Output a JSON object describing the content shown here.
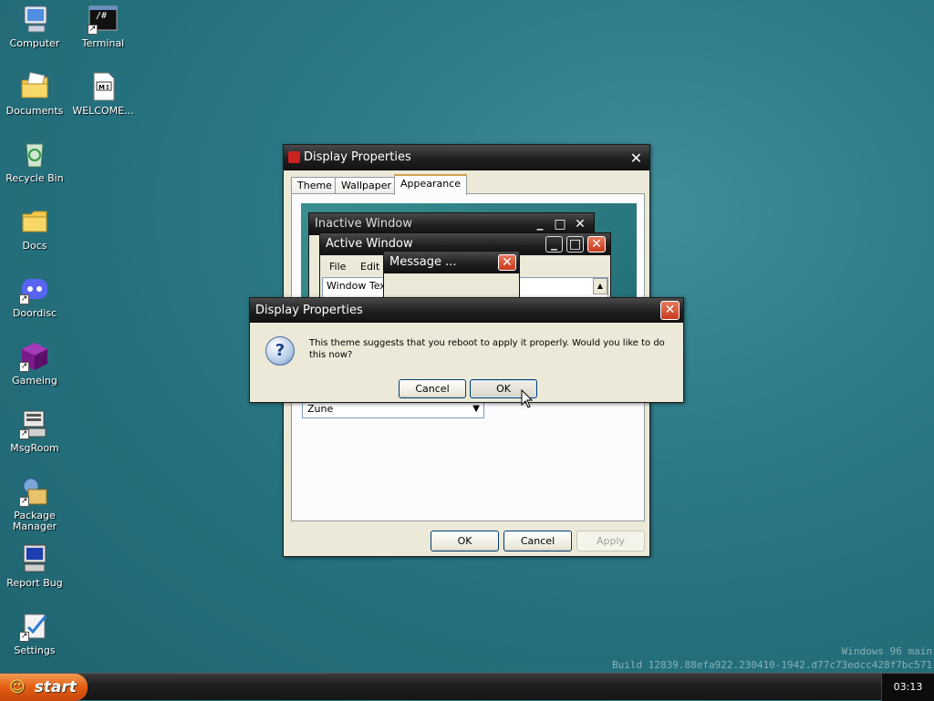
{
  "desktop": {
    "icons": [
      {
        "label": "Computer"
      },
      {
        "label": "Terminal"
      },
      {
        "label": "Documents"
      },
      {
        "label": "WELCOME..."
      },
      {
        "label": "Recycle Bin"
      },
      {
        "label": "Docs"
      },
      {
        "label": "Doordisc"
      },
      {
        "label": "Gameing"
      },
      {
        "label": "MsgRoom"
      },
      {
        "label": "Package Manager"
      },
      {
        "label": "Report Bug"
      },
      {
        "label": "Settings"
      }
    ],
    "terminal_glyph": "/#",
    "welcome_glyph": "M↕"
  },
  "display_properties": {
    "title": "Display Properties",
    "close_glyph": "✕",
    "tabs": [
      "Theme",
      "Wallpaper",
      "Appearance"
    ],
    "active_tab": "Appearance",
    "preview": {
      "inactive_title": "Inactive Window",
      "active_title": "Active Window",
      "menu_file": "File",
      "menu_edit": "Edit",
      "window_text": "Window Text",
      "message_title": "Message ...",
      "minimize_glyph": "_",
      "maximize_glyph": "□",
      "close_glyph": "✕"
    },
    "scheme_select_value": "Zune",
    "buttons": {
      "ok": "OK",
      "cancel": "Cancel",
      "apply": "Apply"
    }
  },
  "dialog": {
    "title": "Display Properties",
    "message": "This theme suggests that you reboot to apply it properly. Would you like to do this now?",
    "question_glyph": "?",
    "close_glyph": "✕",
    "cancel_label": "Cancel",
    "ok_label": "OK"
  },
  "taskbar": {
    "start_label": "start",
    "start_glyph": "☺",
    "clock": "03:13"
  },
  "watermark": {
    "line1": "Windows 96 main",
    "line2": "Build 12839.88efa922.230410-1942.d77c73edcc428f7bc571"
  },
  "colors": {
    "accent_orange": "#e35d12",
    "title_dark": "#1f1f1f",
    "close_red": "#c7391c",
    "desktop_teal": "#2f7d8a"
  }
}
